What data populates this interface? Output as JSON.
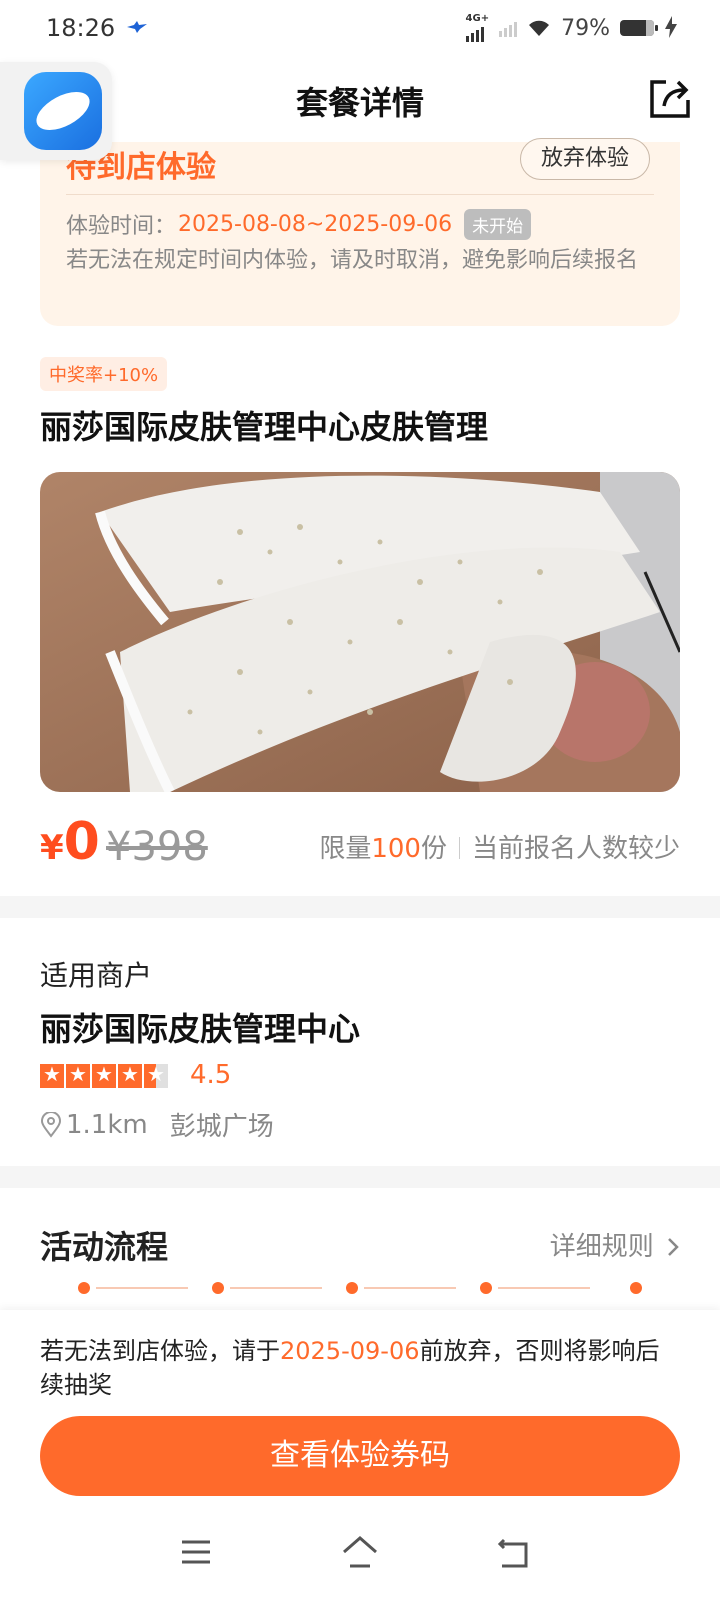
{
  "status_bar": {
    "time": "18:26",
    "network": "4G+",
    "battery": "79%"
  },
  "nav": {
    "title": "套餐详情"
  },
  "status_card": {
    "title": "待到店体验",
    "abandon_label": "放弃体验",
    "time_label": "体验时间：",
    "time_range": "2025-08-08~2025-09-06",
    "time_badge": "未开始",
    "note": "若无法在规定时间内体验，请及时取消，避免影响后续报名"
  },
  "product": {
    "badge": "中奖率+10%",
    "title": "丽莎国际皮肤管理中心皮肤管理",
    "price_symbol": "¥",
    "price_now": "0",
    "price_old": "¥398",
    "limit_prefix": "限量",
    "limit_count": "100",
    "limit_suffix": "份",
    "signup_status": "当前报名人数较少"
  },
  "merchant": {
    "section_label": "适用商户",
    "name": "丽莎国际皮肤管理中心",
    "rating": "4.5",
    "rating_value": 4.5,
    "distance": "1.1km",
    "area": "彭城广场"
  },
  "flow": {
    "title": "活动流程",
    "rules_label": "详细规则",
    "steps_count": 5
  },
  "bottom": {
    "note_prefix": "若无法到店体验，请于",
    "note_date": "2025-09-06",
    "note_suffix": "前放弃，否则将影响后续抽奖",
    "cta_label": "查看体验券码"
  },
  "colors": {
    "accent": "#ff6a2b",
    "card_bg": "#fff4e9"
  }
}
